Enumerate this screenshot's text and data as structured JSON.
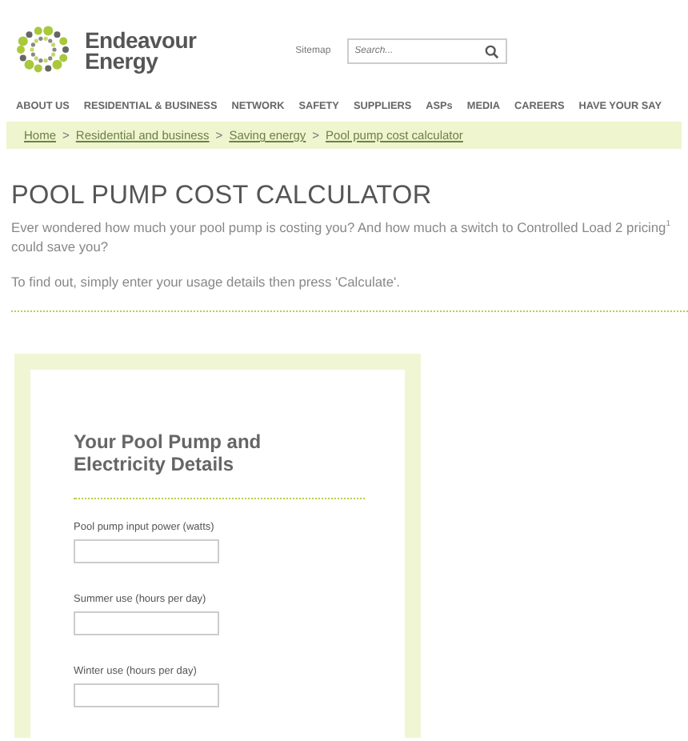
{
  "header": {
    "logo_text": [
      "Endeavour",
      "Energy"
    ],
    "sitemap_link": "Sitemap",
    "search": {
      "placeholder": "Search..."
    }
  },
  "nav": [
    {
      "label": "ABOUT US"
    },
    {
      "label": "RESIDENTIAL & BUSINESS"
    },
    {
      "label": "NETWORK"
    },
    {
      "label": "SAFETY"
    },
    {
      "label": "SUPPLIERS"
    },
    {
      "label": "ASPs"
    },
    {
      "label": "MEDIA"
    },
    {
      "label": "CAREERS"
    },
    {
      "label": "HAVE YOUR SAY"
    }
  ],
  "breadcrumb": [
    {
      "label": "Home"
    },
    {
      "label": "Residential and business"
    },
    {
      "label": "Saving energy"
    },
    {
      "label": "Pool pump cost calculator"
    }
  ],
  "breadcrumb_separator": ">",
  "page_title": "POOL PUMP COST CALCULATOR",
  "intro": "Ever wondered how much your pool pump is costing you? And how much a switch to Controlled Load 2 pricing$^{1}$ could save you?",
  "instruction": "To find out, simply enter your usage details then press 'Calculate'.",
  "form": {
    "heading": "Your Pool Pump and Electricity Details",
    "fields": [
      {
        "label": "Pool pump input power (watts)"
      },
      {
        "label": "Summer use (hours per day)"
      },
      {
        "label": "Winter use (hours per day)"
      }
    ]
  }
}
